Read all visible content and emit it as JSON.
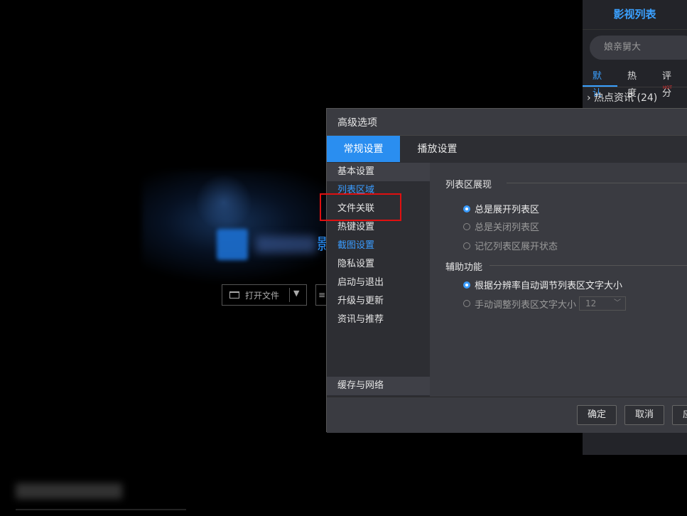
{
  "side_panel": {
    "title": "影视列表",
    "search_placeholder": "娘亲舅大",
    "tabs": [
      "默认",
      "热度",
      "评分"
    ],
    "hot_badge": "HOT",
    "category": "热点资讯 (24)"
  },
  "player": {
    "open_file_label": "打开文件",
    "blue_fragment": "影"
  },
  "dialog": {
    "title": "高级选项",
    "tabs": [
      "常规设置",
      "播放设置"
    ],
    "nav": [
      "基本设置",
      "列表区域",
      "文件关联",
      "热键设置",
      "截图设置",
      "隐私设置",
      "启动与退出",
      "升级与更新",
      "资讯与推荐"
    ],
    "nav_bottom": "缓存与网络",
    "section1": {
      "title": "列表区展现",
      "options": [
        "总是展开列表区",
        "总是关闭列表区",
        "记忆列表区展开状态"
      ]
    },
    "section2": {
      "title": "辅助功能",
      "options": [
        "根据分辨率自动调节列表区文字大小",
        "手动调整列表区文字大小"
      ],
      "font_size_value": "12"
    },
    "buttons": {
      "ok": "确定",
      "cancel": "取消",
      "apply": "应用"
    }
  },
  "colors": {
    "accent": "#2a8ef0",
    "highlight_box": "#e01010"
  }
}
